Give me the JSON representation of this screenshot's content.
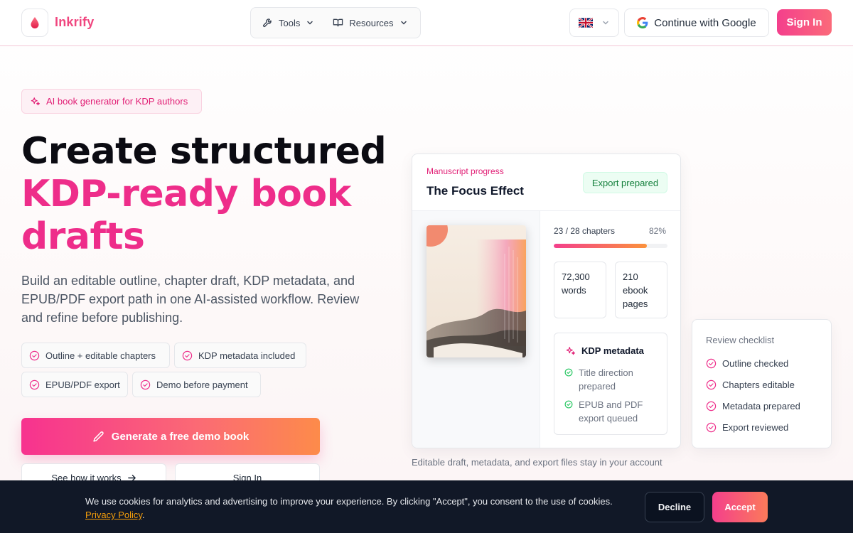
{
  "header": {
    "brand": "Inkrify",
    "nav": [
      {
        "label": "Tools",
        "icon": "wrench-icon"
      },
      {
        "label": "Resources",
        "icon": "book-open-icon"
      }
    ],
    "language_flag": "uk-flag-icon",
    "google_button": "Continue with Google",
    "sign_in": "Sign In"
  },
  "hero": {
    "badge": "AI book generator for KDP authors",
    "title_line1": "Create structured",
    "title_line2": "KDP-ready book",
    "title_line3": "drafts",
    "subtitle": "Build an editable outline, chapter draft, KDP metadata, and EPUB/PDF export path in one AI-assisted workflow. Review and refine before publishing.",
    "features": [
      "Outline + editable chapters",
      "KDP metadata included",
      "EPUB/PDF export",
      "Demo before payment"
    ],
    "cta": "Generate a free demo book",
    "secondary_1": "See how it works",
    "secondary_2": "Sign In"
  },
  "manuscript": {
    "kicker": "Manuscript progress",
    "title": "The Focus Effect",
    "status": "Export prepared",
    "chapters": "23 / 28 chapters",
    "percent": "82%",
    "progress_value": 0.82,
    "words_value": "72,300",
    "words_label": "words",
    "pages_value": "210",
    "pages_label_1": "ebook",
    "pages_label_2": "pages",
    "kdp_title": "KDP metadata",
    "kdp_items": [
      {
        "line1": "Title direction",
        "line2": "prepared"
      },
      {
        "line1": "EPUB and PDF",
        "line2": "export queued"
      }
    ],
    "caption": "Editable draft, metadata, and export files stay in your account"
  },
  "review": {
    "title": "Review checklist",
    "items": [
      "Outline checked",
      "Chapters editable",
      "Metadata prepared",
      "Export reviewed"
    ]
  },
  "cookie": {
    "text": "We use cookies for analytics and advertising to improve your experience. By clicking \"Accept\", you consent to the use of cookies.",
    "link": "Privacy Policy",
    "link_suffix": ".",
    "decline": "Decline",
    "accept": "Accept"
  },
  "colors": {
    "brand": "#f0467f",
    "accent_pink": "#ee2d8a",
    "accent_orange": "#fb923c",
    "success": "#15803d",
    "cookie_bg": "#111827"
  }
}
